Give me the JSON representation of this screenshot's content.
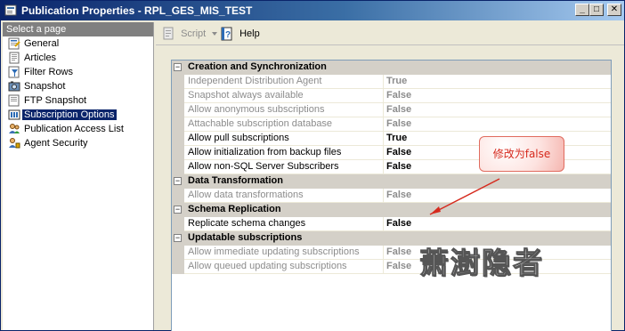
{
  "window": {
    "title": "Publication Properties - RPL_GES_MIS_TEST",
    "minimize": "_",
    "maximize": "□",
    "close": "✕"
  },
  "left_pane": {
    "header": "Select a page",
    "items": [
      {
        "label": "General",
        "icon": "general-page-icon",
        "selected": false
      },
      {
        "label": "Articles",
        "icon": "articles-page-icon",
        "selected": false
      },
      {
        "label": "Filter Rows",
        "icon": "filter-page-icon",
        "selected": false
      },
      {
        "label": "Snapshot",
        "icon": "snapshot-page-icon",
        "selected": false
      },
      {
        "label": "FTP Snapshot",
        "icon": "ftp-page-icon",
        "selected": false
      },
      {
        "label": "Subscription Options",
        "icon": "subscription-page-icon",
        "selected": true
      },
      {
        "label": "Publication Access List",
        "icon": "access-list-page-icon",
        "selected": false
      },
      {
        "label": "Agent Security",
        "icon": "agent-security-page-icon",
        "selected": false
      }
    ]
  },
  "toolbar": {
    "script_label": "Script",
    "help_label": "Help"
  },
  "grid": {
    "categories": [
      {
        "label": "Creation and Synchronization",
        "props": [
          {
            "name": "Independent Distribution Agent",
            "value": "True",
            "enabled": false
          },
          {
            "name": "Snapshot always available",
            "value": "False",
            "enabled": false
          },
          {
            "name": "Allow anonymous subscriptions",
            "value": "False",
            "enabled": false
          },
          {
            "name": "Attachable subscription database",
            "value": "False",
            "enabled": false
          },
          {
            "name": "Allow pull subscriptions",
            "value": "True",
            "enabled": true
          },
          {
            "name": "Allow initialization from backup files",
            "value": "False",
            "enabled": true
          },
          {
            "name": "Allow non-SQL Server Subscribers",
            "value": "False",
            "enabled": true
          }
        ]
      },
      {
        "label": "Data Transformation",
        "props": [
          {
            "name": "Allow data transformations",
            "value": "False",
            "enabled": false
          }
        ]
      },
      {
        "label": "Schema Replication",
        "props": [
          {
            "name": "Replicate schema changes",
            "value": "False",
            "enabled": true
          }
        ]
      },
      {
        "label": "Updatable subscriptions",
        "props": [
          {
            "name": "Allow immediate updating subscriptions",
            "value": "False",
            "enabled": false
          },
          {
            "name": "Allow queued updating subscriptions",
            "value": "False",
            "enabled": false
          }
        ]
      }
    ]
  },
  "annotation": {
    "callout_text": "修改为false",
    "watermark_text": "萧澍隐者",
    "callout_color": "#d62a1e"
  }
}
